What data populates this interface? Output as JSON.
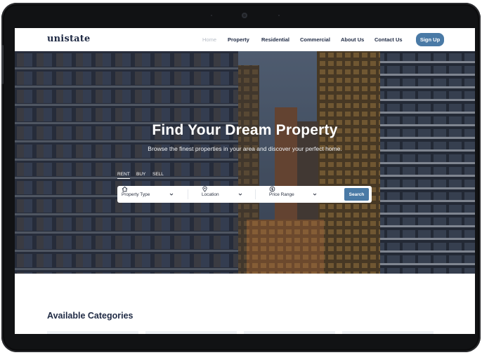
{
  "nav": {
    "logo": "unistate",
    "links": [
      {
        "label": "Home",
        "active": true
      },
      {
        "label": "Property"
      },
      {
        "label": "Residential"
      },
      {
        "label": "Commercial"
      },
      {
        "label": "About Us"
      },
      {
        "label": "Contact Us"
      }
    ],
    "signup_label": "Sign Up"
  },
  "hero": {
    "title": "Find Your Dream Property",
    "subtitle": "Browse the finest properties in your area and discover your perfect home.",
    "tabs": [
      {
        "label": "RENT",
        "active": true
      },
      {
        "label": "BUY"
      },
      {
        "label": "SELL"
      }
    ],
    "search": {
      "property_type": "Property Type",
      "location": "Location",
      "price_range": "Price Range",
      "button_label": "Search"
    }
  },
  "sections": {
    "categories_title": "Available Categories"
  },
  "colors": {
    "accent": "#4a7aa6",
    "navy": "#1f2a44",
    "device_frame": "#111214"
  },
  "icons": [
    "home-icon",
    "location-pin-icon",
    "price-icon",
    "chevron-down-icon",
    "camera-icon"
  ]
}
